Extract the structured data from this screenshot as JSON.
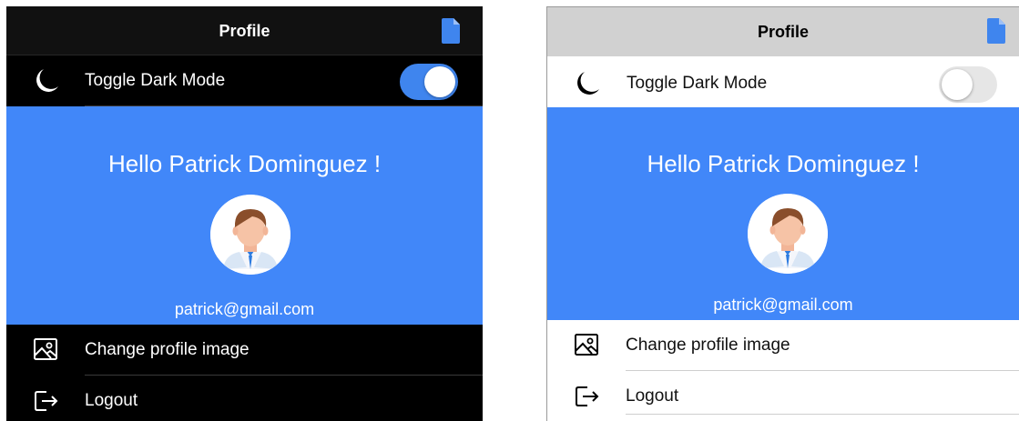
{
  "screens": {
    "dark": {
      "title": "Profile",
      "toggle_label": "Toggle Dark Mode",
      "dark_mode_on": true,
      "greeting": "Hello Patrick Dominguez !",
      "email": "patrick@gmail.com",
      "change_image_label": "Change profile image",
      "logout_label": "Logout"
    },
    "light": {
      "title": "Profile",
      "toggle_label": "Toggle Dark Mode",
      "dark_mode_on": false,
      "greeting": "Hello Patrick Dominguez !",
      "email": "patrick@gmail.com",
      "change_image_label": "Change profile image",
      "logout_label": "Logout"
    }
  },
  "icons": {
    "nav_action": "document-icon",
    "toggle": "moon-icon",
    "change_image": "image-icon",
    "logout": "logout-icon"
  },
  "colors": {
    "accent": "#4187f9",
    "toggle_on": "#3f85ee",
    "dark_background": "#000000",
    "light_navbar": "#d1d1d1"
  }
}
